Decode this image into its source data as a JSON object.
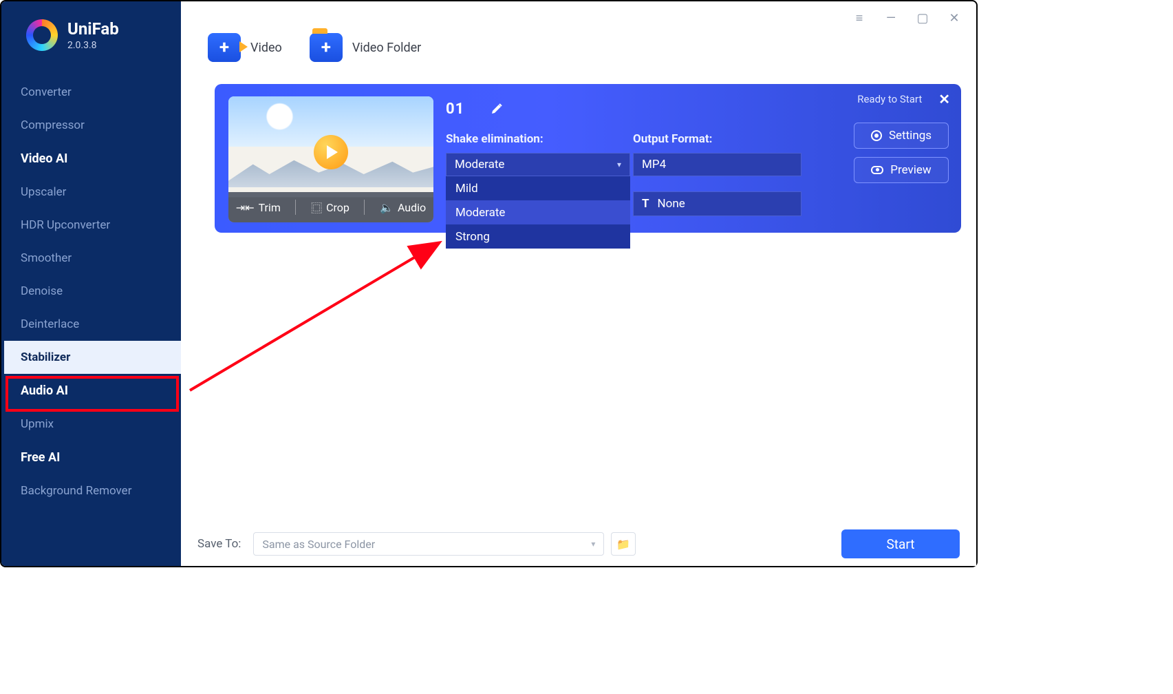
{
  "brand": {
    "name": "UniFab",
    "version": "2.0.3.8"
  },
  "nav": {
    "items": [
      {
        "label": "Converter"
      },
      {
        "label": "Compressor"
      },
      {
        "label": "Video AI",
        "header": true
      },
      {
        "label": "Upscaler"
      },
      {
        "label": "HDR Upconverter"
      },
      {
        "label": "Smoother"
      },
      {
        "label": "Denoise"
      },
      {
        "label": "Deinterlace"
      },
      {
        "label": "Stabilizer",
        "active": true
      },
      {
        "label": "Audio AI",
        "header": true
      },
      {
        "label": "Upmix"
      },
      {
        "label": "Free AI",
        "header": true
      },
      {
        "label": "Background Remover"
      }
    ]
  },
  "add": {
    "video": "Video",
    "folder": "Video Folder"
  },
  "card": {
    "status": "Ready to Start",
    "index": "01",
    "shake_label": "Shake elimination:",
    "shake_value": "Moderate",
    "shake_options": [
      "Mild",
      "Moderate",
      "Strong"
    ],
    "output_label": "Output Format:",
    "output_value": "MP4",
    "subtitle_value": "None",
    "tools": {
      "trim": "Trim",
      "crop": "Crop",
      "audio": "Audio"
    },
    "settings": "Settings",
    "preview": "Preview"
  },
  "bottom": {
    "save_label": "Save To:",
    "save_value": "Same as Source Folder",
    "start": "Start"
  }
}
